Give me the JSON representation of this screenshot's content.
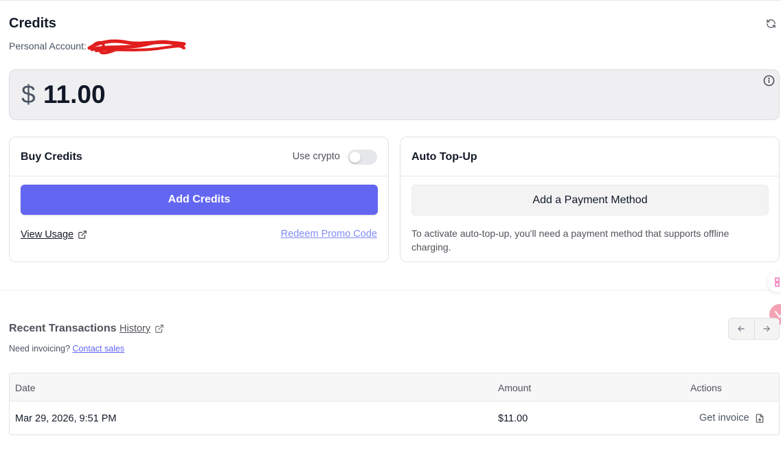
{
  "header": {
    "title": "Credits",
    "account_label": "Personal Account:",
    "refresh_icon": "refresh-icon"
  },
  "balance": {
    "currency": "$",
    "amount": "11.00",
    "info_icon": "info-icon"
  },
  "buy_credits": {
    "title": "Buy Credits",
    "crypto_label": "Use crypto",
    "crypto_enabled": false,
    "add_button": "Add Credits",
    "view_usage": "View Usage",
    "redeem": "Redeem Promo Code"
  },
  "auto_topup": {
    "title": "Auto Top-Up",
    "add_payment_button": "Add a Payment Method",
    "note": "To activate auto-top-up, you'll need a payment method that supports offline charging."
  },
  "transactions": {
    "title": "Recent Transactions",
    "history_link": "History",
    "invoicing_prompt": "Need invoicing?",
    "contact_sales": "Contact sales",
    "columns": {
      "date": "Date",
      "amount": "Amount",
      "actions": "Actions"
    },
    "rows": [
      {
        "date": "Mar 29, 2026, 9:51 PM",
        "amount": "$11.00",
        "action": "Get invoice"
      }
    ]
  },
  "colors": {
    "accent": "#6366f1",
    "link": "#818cf8",
    "redaction": "#e11d1d"
  }
}
